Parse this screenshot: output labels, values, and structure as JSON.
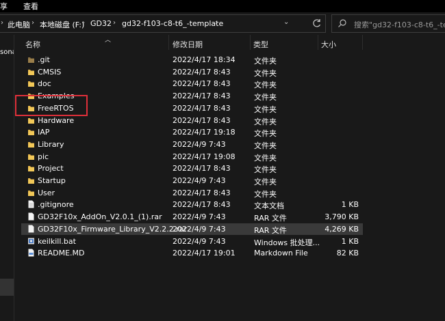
{
  "menu": {
    "item1": "享",
    "item2": "查看"
  },
  "breadcrumb": {
    "items": [
      "此电脑",
      "本地磁盘 (F:)",
      "GD32",
      "gd32-f103-c8-t6_-template"
    ]
  },
  "search": {
    "placeholder": "搜索\"gd32-f103-c8-t6_-temp"
  },
  "left_pane": {
    "partial_label": "sona"
  },
  "columns": {
    "name": "名称",
    "date": "修改日期",
    "type": "类型",
    "size": "大小"
  },
  "files": [
    {
      "name": ".git",
      "date": "2022/4/17 18:34",
      "type": "文件夹",
      "size": "",
      "icon": "folder-dim-icon"
    },
    {
      "name": "CMSIS",
      "date": "2022/4/17 8:43",
      "type": "文件夹",
      "size": "",
      "icon": "folder-icon"
    },
    {
      "name": "doc",
      "date": "2022/4/17 8:43",
      "type": "文件夹",
      "size": "",
      "icon": "folder-icon"
    },
    {
      "name": "Examples",
      "date": "2022/4/17 8:43",
      "type": "文件夹",
      "size": "",
      "icon": "folder-icon"
    },
    {
      "name": "FreeRTOS",
      "date": "2022/4/17 8:43",
      "type": "文件夹",
      "size": "",
      "icon": "folder-icon"
    },
    {
      "name": "Hardware",
      "date": "2022/4/17 8:43",
      "type": "文件夹",
      "size": "",
      "icon": "folder-icon"
    },
    {
      "name": "IAP",
      "date": "2022/4/17 19:18",
      "type": "文件夹",
      "size": "",
      "icon": "folder-icon"
    },
    {
      "name": "Library",
      "date": "2022/4/9 7:43",
      "type": "文件夹",
      "size": "",
      "icon": "folder-icon"
    },
    {
      "name": "pic",
      "date": "2022/4/17 19:08",
      "type": "文件夹",
      "size": "",
      "icon": "folder-icon"
    },
    {
      "name": "Project",
      "date": "2022/4/17 8:43",
      "type": "文件夹",
      "size": "",
      "icon": "folder-icon"
    },
    {
      "name": "Startup",
      "date": "2022/4/9 7:43",
      "type": "文件夹",
      "size": "",
      "icon": "folder-icon"
    },
    {
      "name": "User",
      "date": "2022/4/17 8:43",
      "type": "文件夹",
      "size": "",
      "icon": "folder-icon"
    },
    {
      "name": ".gitignore",
      "date": "2022/4/17 8:43",
      "type": "文本文档",
      "size": "1 KB",
      "icon": "text-file-icon"
    },
    {
      "name": "GD32F10x_AddOn_V2.0.1_(1).rar",
      "date": "2022/4/9 7:43",
      "type": "RAR 文件",
      "size": "3,790 KB",
      "icon": "archive-file-icon"
    },
    {
      "name": "GD32F10x_Firmware_Library_V2.2.2.rar",
      "date": "2022/4/9 7:43",
      "type": "RAR 文件",
      "size": "4,269 KB",
      "icon": "archive-file-icon",
      "selected": true
    },
    {
      "name": "keilkill.bat",
      "date": "2022/4/9 7:43",
      "type": "Windows 批处理...",
      "size": "1 KB",
      "icon": "batch-file-icon"
    },
    {
      "name": "README.MD",
      "date": "2022/4/17 19:01",
      "type": "Markdown File",
      "size": "82 KB",
      "icon": "markdown-file-icon"
    }
  ],
  "colors": {
    "background": "#191919",
    "selected_row": "#3a3a3a",
    "folder": "#e8b84a",
    "highlight": "#e0303a"
  }
}
